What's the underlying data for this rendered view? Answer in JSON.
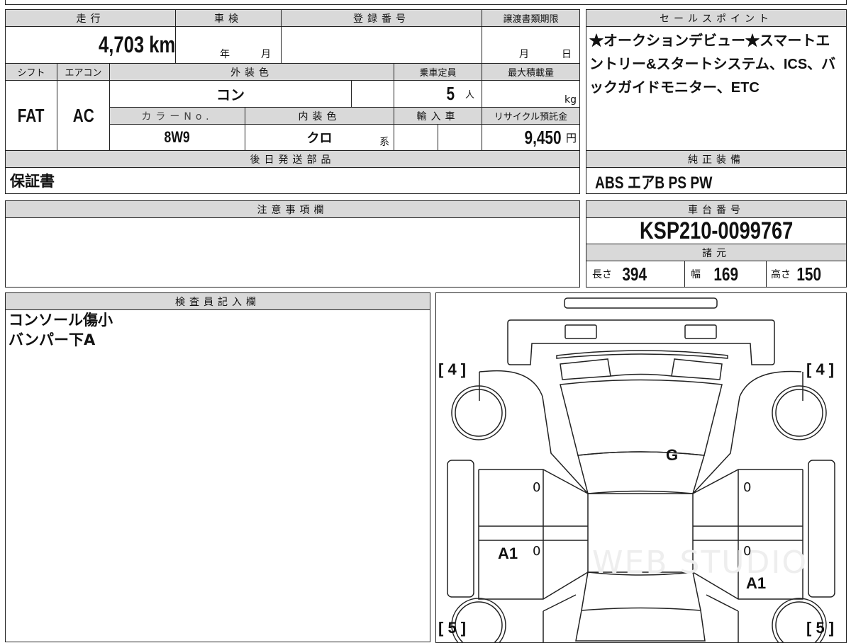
{
  "headers": {
    "mileage": "走行",
    "inspection": "車検",
    "registration": "登録番号",
    "transfer_deadline": "譲渡書類期限",
    "shift": "シフト",
    "aircon": "エアコン",
    "exterior_color": "外装色",
    "capacity": "乗車定員",
    "max_load": "最大積載量",
    "color_no": "カラーNo.",
    "interior_color": "内装色",
    "import": "輸入車",
    "recycle": "リサイクル預託金",
    "later_parts": "後日発送部品",
    "sales_point": "セールスポイント",
    "standard_equipment": "純正装備",
    "notes": "注意事項欄",
    "chassis": "車台番号",
    "specs": "諸元",
    "inspector": "検査員記入欄"
  },
  "values": {
    "mileage": "4,703 km",
    "year_unit": "年",
    "month_unit": "月",
    "day_unit": "日",
    "shift": "FAT",
    "aircon": "AC",
    "exterior_color": "コン",
    "capacity": "5",
    "capacity_unit": "人",
    "max_load_unit": "kg",
    "color_no": "8W9",
    "interior_color": "クロ",
    "interior_suffix": "系",
    "recycle": "9,450",
    "recycle_unit": "円",
    "later_parts": "保証書",
    "sales_point": "★オークションデビュー★スマートエントリー&スタートシステム、ICS、バックガイドモニター、ETC",
    "standard_equipment": "ABS エアB PS PW",
    "chassis": "KSP210-0099767",
    "length_label": "長さ",
    "length": "394",
    "width_label": "幅",
    "width": "169",
    "height_label": "高さ",
    "height": "150",
    "inspector_line1": "コンソール傷小",
    "inspector_line2": "バンパー下A"
  },
  "diagram": {
    "front_left": "[ 4 ]",
    "front_right": "[ 4 ]",
    "rear_left": "[ 5 ]",
    "rear_right": "[ 5 ]",
    "windshield": "G",
    "door_fl": "0",
    "door_fr": "0",
    "door_rl": "0",
    "door_rr": "0",
    "rear_left_fender": "A1",
    "rear_right_fender": "A1",
    "watermark": "WEB STUDIO"
  }
}
